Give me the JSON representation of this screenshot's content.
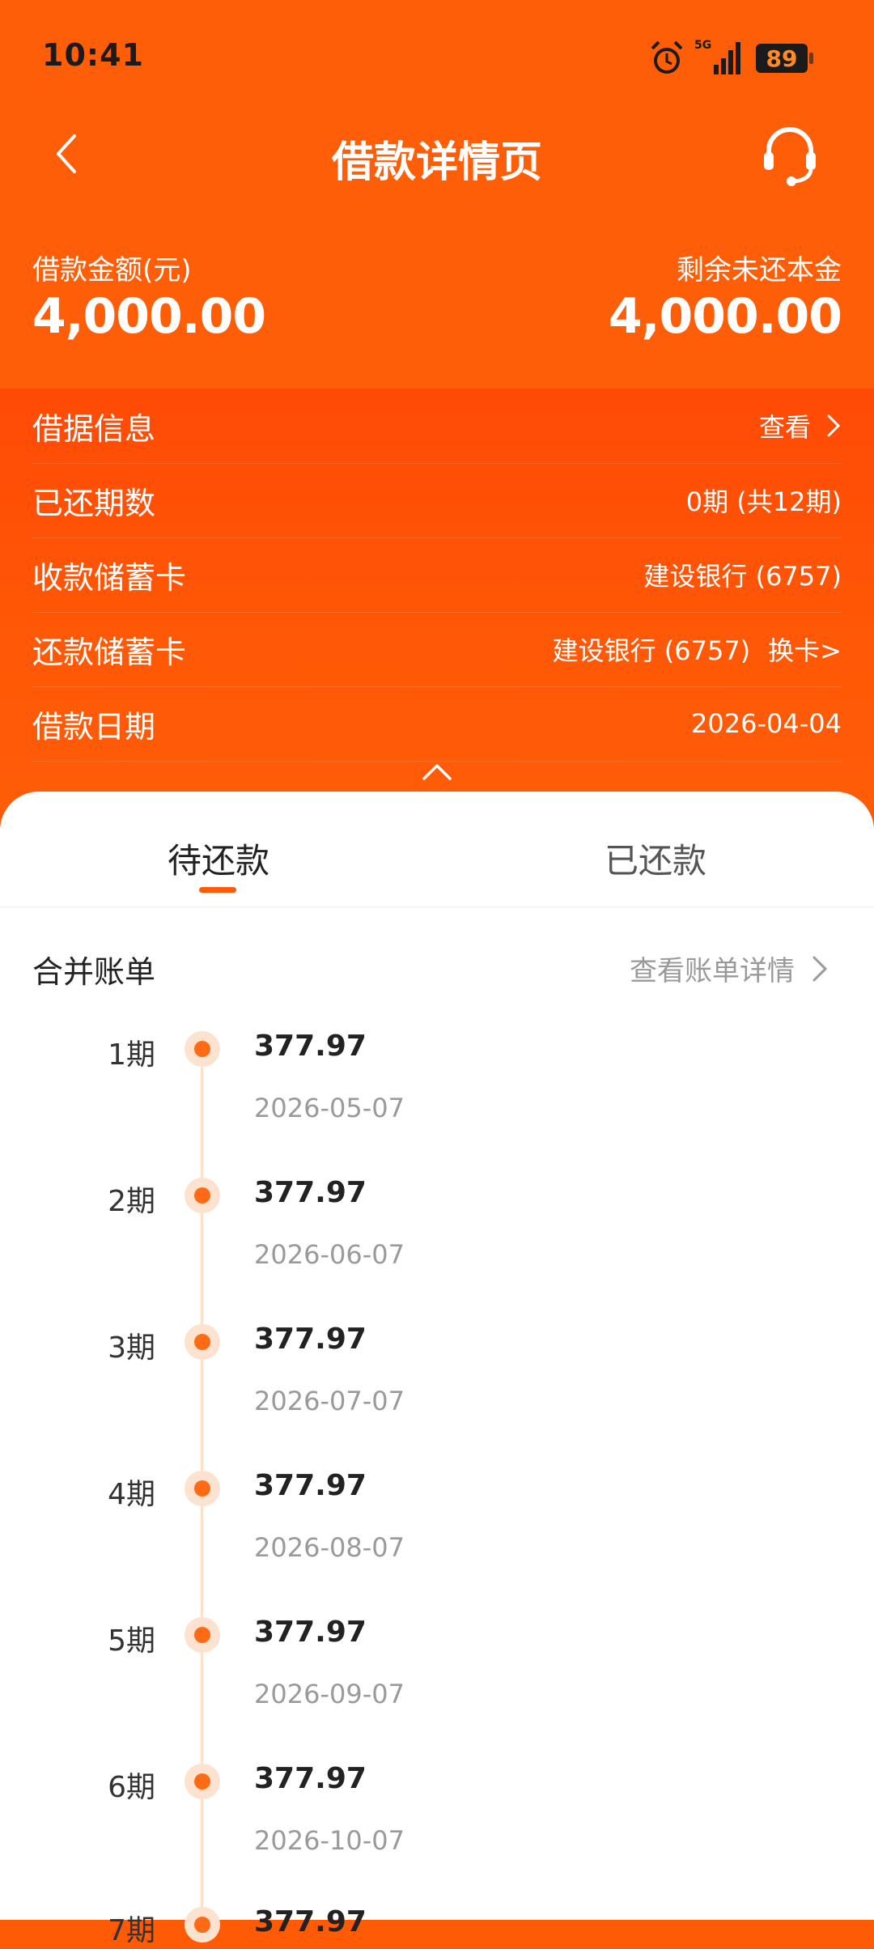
{
  "status": {
    "time": "10:41",
    "network": "5G",
    "battery": "89"
  },
  "nav": {
    "title": "借款详情页"
  },
  "summary": {
    "loan_amount_label": "借款金额(元)",
    "loan_amount": "4,000.00",
    "remaining_label": "剩余未还本金",
    "remaining": "4,000.00"
  },
  "info_rows": [
    {
      "label": "借据信息",
      "value": "查看"
    },
    {
      "label": "已还期数",
      "value": "0期 (共12期)"
    },
    {
      "label": "收款储蓄卡",
      "value": "建设银行 (6757)"
    },
    {
      "label": "还款储蓄卡",
      "value": "建设银行 (6757)",
      "extra": "换卡>"
    },
    {
      "label": "借款日期",
      "value": "2026-04-04"
    }
  ],
  "tabs": [
    {
      "label": "待还款",
      "active": true
    },
    {
      "label": "已还款",
      "active": false
    }
  ],
  "merged_bill": {
    "title": "合并账单",
    "link": "查看账单详情"
  },
  "installments": [
    {
      "period": "1期",
      "amount": "377.97",
      "date": "2026-05-07"
    },
    {
      "period": "2期",
      "amount": "377.97",
      "date": "2026-06-07"
    },
    {
      "period": "3期",
      "amount": "377.97",
      "date": "2026-07-07"
    },
    {
      "period": "4期",
      "amount": "377.97",
      "date": "2026-08-07"
    },
    {
      "period": "5期",
      "amount": "377.97",
      "date": "2026-09-07"
    },
    {
      "period": "6期",
      "amount": "377.97",
      "date": "2026-10-07"
    },
    {
      "period": "7期",
      "amount": "377.97",
      "date": ""
    }
  ],
  "colors": {
    "brand_orange": "#ff5a05",
    "dot": "#ff6a14",
    "timeline": "#fde0c6"
  }
}
